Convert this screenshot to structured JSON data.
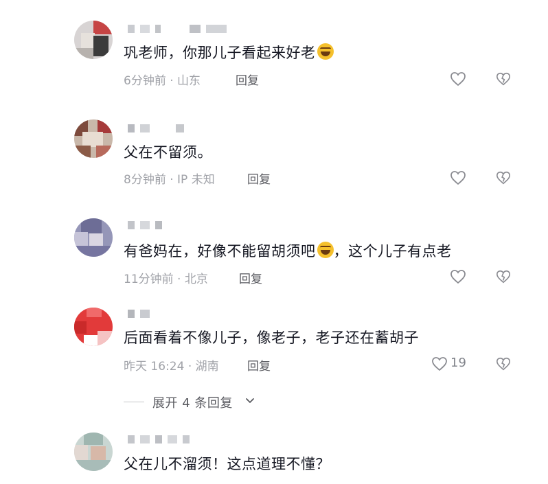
{
  "comments": [
    {
      "text": "巩老师，你那儿子看起来好老",
      "emoji_after": true,
      "time": "6分钟前",
      "location": "山东",
      "reply_label": "回复",
      "likes": ""
    },
    {
      "text": "父在不留须。",
      "time": "8分钟前",
      "location": "IP 未知",
      "reply_label": "回复",
      "likes": ""
    },
    {
      "text_before": "有爸妈在，好像不能留胡须吧",
      "text_after": "，这个儿子有点老",
      "time": "11分钟前",
      "location": "北京",
      "reply_label": "回复",
      "likes": ""
    },
    {
      "text": "后面看着不像儿子，像老子，老子还在蓄胡子",
      "time": "昨天 16:24",
      "location": "湖南",
      "reply_label": "回复",
      "likes": "19"
    },
    {
      "text": "父在儿不溜须！这点道理不懂？"
    }
  ],
  "expand_replies": {
    "label": "展开 4 条回复"
  },
  "separator": "·",
  "icons": {
    "like": "heart-outline-icon",
    "dislike": "broken-heart-icon",
    "expand": "chevron-down-icon",
    "emoji": "laughing-tears-emoji-icon"
  },
  "colors": {
    "text": "#161823",
    "meta": "#a0a2a8",
    "reply": "#58595f",
    "icon": "#8a8b91"
  }
}
